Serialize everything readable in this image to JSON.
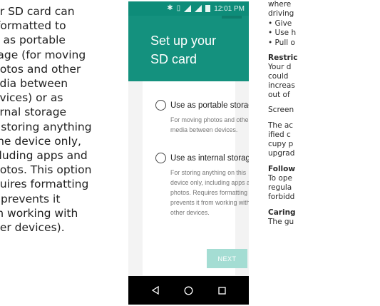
{
  "left_text": "ur SD card can\n formatted to\ne as portable\nrage (for moving\nhotos and other\nedia between\nevices) or as\nernal storage\nr storing anything\nthe device only,\ncluding apps and\nhotos. This option\nquires formatting\nt prevents it\nm working with\nher devices).",
  "phone": {
    "status_time": "12:01 PM",
    "title": "Set up your\nSD card",
    "options": [
      {
        "label": "Use as portable storage",
        "description": "For moving photos and other\nmedia between devices."
      },
      {
        "label": "Use as internal storage",
        "description": "For storing anything on this\ndevice only, including apps and\nphotos. Requires formatting that\nprevents it from working with\nother devices."
      }
    ],
    "next_label": "NEXT"
  },
  "right_text": [
    {
      "text": "where",
      "bold": false
    },
    {
      "text": "driving",
      "bold": false
    },
    {
      "text": "• Give",
      "bold": false
    },
    {
      "text": "• Use h",
      "bold": false
    },
    {
      "text": "• Pull o",
      "bold": false
    },
    {
      "text": "Restric",
      "bold": true
    },
    {
      "text": "Your d",
      "bold": false
    },
    {
      "text": "could",
      "bold": false
    },
    {
      "text": "increas",
      "bold": false
    },
    {
      "text": "out of",
      "bold": false
    },
    {
      "text": "Screen",
      "bold": false
    },
    {
      "text": "The ac",
      "bold": false
    },
    {
      "text": "ified c",
      "bold": false
    },
    {
      "text": "cupy p",
      "bold": false
    },
    {
      "text": "upgrad",
      "bold": false
    },
    {
      "text": "Follow",
      "bold": true
    },
    {
      "text": "To ope",
      "bold": false
    },
    {
      "text": "regula",
      "bold": false
    },
    {
      "text": "forbidd",
      "bold": false
    },
    {
      "text": "Caring",
      "bold": true
    },
    {
      "text": "The gu",
      "bold": false
    }
  ],
  "colors": {
    "header": "#14917e",
    "status_bar": "#0e8c79",
    "next_button": "#a4ddd3"
  }
}
